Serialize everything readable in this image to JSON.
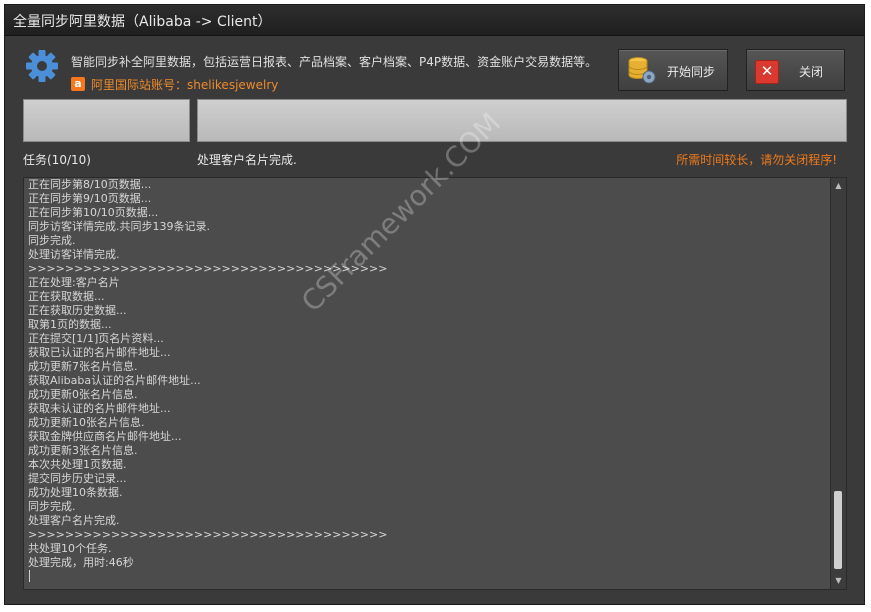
{
  "window": {
    "title": "全量同步阿里数据（Alibaba -> Client）"
  },
  "header": {
    "description": "智能同步补全阿里数据，包括运营日报表、产品档案、客户档案、P4P数据、资金账户交易数据等。",
    "account_text": "阿里国际站账号：shelikesjewelry",
    "sync_button_label": "开始同步",
    "close_button_label": "关闭"
  },
  "progress": {
    "task_label": "任务(10/10)",
    "status_text": "处理客户名片完成.",
    "warning_text": "所需时间较长，请勿关闭程序!"
  },
  "log": {
    "lines": [
      "正在同步第8/10页数据...",
      "正在同步第9/10页数据...",
      "正在同步第10/10页数据...",
      "同步访客详情完成.共同步139条记录.",
      "同步完成.",
      "处理访客详情完成.",
      ">>>>>>>>>>>>>>>>>>>>>>>>>>>>>>>>>>>>>>>",
      "正在处理:客户名片",
      "正在获取数据...",
      "正在获取历史数据...",
      "取第1页的数据...",
      "正在提交[1/1]页名片资料...",
      "获取已认证的名片邮件地址...",
      "成功更新7张名片信息.",
      "获取Alibaba认证的名片邮件地址...",
      "成功更新0张名片信息.",
      "获取未认证的名片邮件地址...",
      "成功更新10张名片信息.",
      "获取金牌供应商名片邮件地址...",
      "成功更新3张名片信息.",
      "本次共处理1页数据.",
      "提交同步历史记录...",
      "成功处理10条数据.",
      "同步完成.",
      "处理客户名片完成.",
      ">>>>>>>>>>>>>>>>>>>>>>>>>>>>>>>>>>>>>>>",
      "共处理10个任务.",
      "处理完成，用时:46秒"
    ]
  },
  "watermark": "CSFramework.COM",
  "icons": {
    "settings": "gear-icon",
    "alibaba": "alibaba-icon",
    "database": "database-sync-icon",
    "close": "close-icon"
  },
  "colors": {
    "window_bg": "#3a3a3a",
    "accent_orange": "#f07a1a",
    "log_bg": "#4c4c4c",
    "close_red": "#d9392e",
    "gear_blue": "#4a8fd8"
  }
}
